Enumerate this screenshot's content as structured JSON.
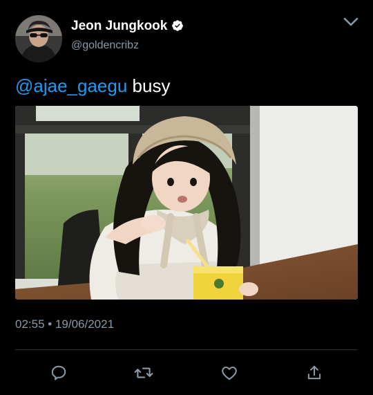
{
  "author": {
    "display_name": "Jeon Jungkook",
    "handle": "@goldencribz",
    "verified": true,
    "avatar_icon": "profile-photo"
  },
  "tweet": {
    "mention": "@ajae_gaegu",
    "text": " busy",
    "media_description_icon": "attached-photo"
  },
  "meta": {
    "timestamp": "02:55 • 19/06/2021"
  },
  "actions": [
    {
      "icon": "reply-icon"
    },
    {
      "icon": "retweet-icon"
    },
    {
      "icon": "like-icon"
    },
    {
      "icon": "share-icon"
    }
  ],
  "colors": {
    "background": "#000000",
    "text_primary": "#ffffff",
    "text_secondary": "#8b98a5",
    "mention": "#1d9bf0",
    "divider": "#2f3336",
    "icon": "#8b98a5"
  }
}
